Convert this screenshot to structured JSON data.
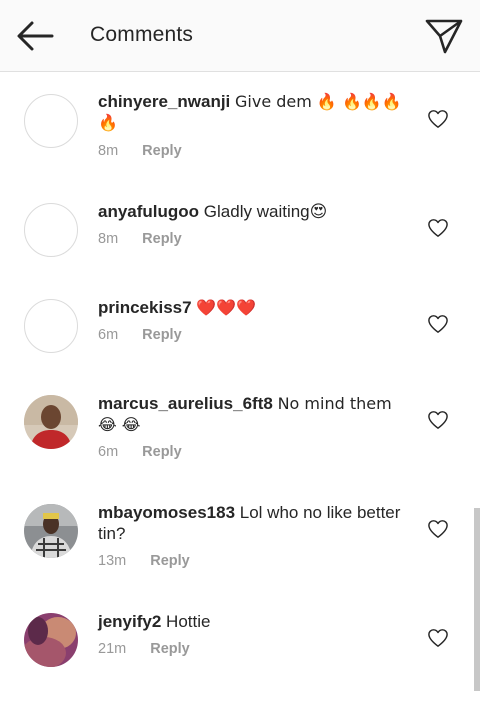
{
  "header": {
    "title": "Comments"
  },
  "comments": [
    {
      "username": "chinyere_nwanji",
      "text": "Give dem 🔥 🔥🔥🔥 🔥",
      "time": "8m",
      "reply": "Reply",
      "avatar": "blank"
    },
    {
      "username": "anyafulugoo",
      "text": "Gladly waiting😍",
      "time": "8m",
      "reply": "Reply",
      "avatar": "blank"
    },
    {
      "username": "princekiss7",
      "text": "❤️❤️❤️",
      "time": "6m",
      "reply": "Reply",
      "avatar": "blank"
    },
    {
      "username": "marcus_aurelius_6ft8",
      "text": "No mind them😂 😂",
      "time": "6m",
      "reply": "Reply",
      "avatar": "photo-man-red-shirt"
    },
    {
      "username": "mbayomoses183",
      "text": "Lol who no like better tin?",
      "time": "13m",
      "reply": "Reply",
      "avatar": "photo-man-plaid-shirt"
    },
    {
      "username": "jenyify2",
      "text": "Hottie",
      "time": "21m",
      "reply": "Reply",
      "avatar": "photo-woman"
    }
  ],
  "icons": {
    "back": "arrow-left-icon",
    "send": "paper-plane-icon",
    "like": "heart-outline-icon"
  },
  "colors": {
    "meta": "#999999",
    "text": "#262626",
    "divider": "#e0e0e0"
  }
}
